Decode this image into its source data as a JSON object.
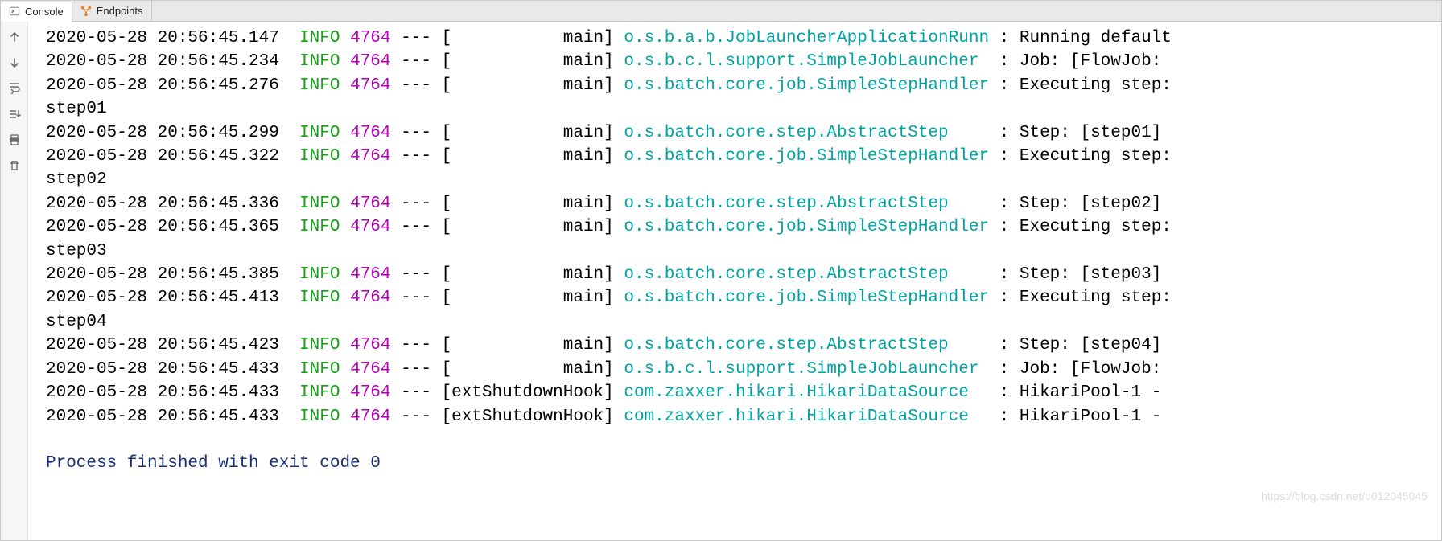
{
  "tabs": {
    "console": "Console",
    "endpoints": "Endpoints"
  },
  "log": {
    "thread_main": "           main",
    "thread_hook": "extShutdownHook",
    "lines": [
      {
        "ts": "2020-05-28 20:56:45.147",
        "lvl": "INFO",
        "pid": "4764",
        "thread": "main",
        "logger": "o.s.b.a.b.JobLauncherApplicationRunner",
        "msg": "Running default"
      },
      {
        "ts": "2020-05-28 20:56:45.234",
        "lvl": "INFO",
        "pid": "4764",
        "thread": "main",
        "logger": "o.s.b.c.l.support.SimpleJobLauncher  ",
        "msg": "Job: [FlowJob: "
      },
      {
        "ts": "2020-05-28 20:56:45.276",
        "lvl": "INFO",
        "pid": "4764",
        "thread": "main",
        "logger": "o.s.batch.core.job.SimpleStepHandler",
        "msg": "Executing step:"
      },
      {
        "plain": "step01"
      },
      {
        "ts": "2020-05-28 20:56:45.299",
        "lvl": "INFO",
        "pid": "4764",
        "thread": "main",
        "logger": "o.s.batch.core.step.AbstractStep    ",
        "msg": "Step: [step01] "
      },
      {
        "ts": "2020-05-28 20:56:45.322",
        "lvl": "INFO",
        "pid": "4764",
        "thread": "main",
        "logger": "o.s.batch.core.job.SimpleStepHandler",
        "msg": "Executing step:"
      },
      {
        "plain": "step02"
      },
      {
        "ts": "2020-05-28 20:56:45.336",
        "lvl": "INFO",
        "pid": "4764",
        "thread": "main",
        "logger": "o.s.batch.core.step.AbstractStep    ",
        "msg": "Step: [step02] "
      },
      {
        "ts": "2020-05-28 20:56:45.365",
        "lvl": "INFO",
        "pid": "4764",
        "thread": "main",
        "logger": "o.s.batch.core.job.SimpleStepHandler",
        "msg": "Executing step:"
      },
      {
        "plain": "step03"
      },
      {
        "ts": "2020-05-28 20:56:45.385",
        "lvl": "INFO",
        "pid": "4764",
        "thread": "main",
        "logger": "o.s.batch.core.step.AbstractStep    ",
        "msg": "Step: [step03] "
      },
      {
        "ts": "2020-05-28 20:56:45.413",
        "lvl": "INFO",
        "pid": "4764",
        "thread": "main",
        "logger": "o.s.batch.core.job.SimpleStepHandler",
        "msg": "Executing step:"
      },
      {
        "plain": "step04"
      },
      {
        "ts": "2020-05-28 20:56:45.423",
        "lvl": "INFO",
        "pid": "4764",
        "thread": "main",
        "logger": "o.s.batch.core.step.AbstractStep    ",
        "msg": "Step: [step04] "
      },
      {
        "ts": "2020-05-28 20:56:45.433",
        "lvl": "INFO",
        "pid": "4764",
        "thread": "main",
        "logger": "o.s.b.c.l.support.SimpleJobLauncher  ",
        "msg": "Job: [FlowJob: "
      },
      {
        "ts": "2020-05-28 20:56:45.433",
        "lvl": "INFO",
        "pid": "4764",
        "thread": "hook",
        "logger": "com.zaxxer.hikari.HikariDataSource  ",
        "msg": "HikariPool-1 - "
      },
      {
        "ts": "2020-05-28 20:56:45.433",
        "lvl": "INFO",
        "pid": "4764",
        "thread": "hook",
        "logger": "com.zaxxer.hikari.HikariDataSource  ",
        "msg": "HikariPool-1 - "
      }
    ],
    "final": "Process finished with exit code 0"
  },
  "watermark": "https://blog.csdn.net/u012045045"
}
